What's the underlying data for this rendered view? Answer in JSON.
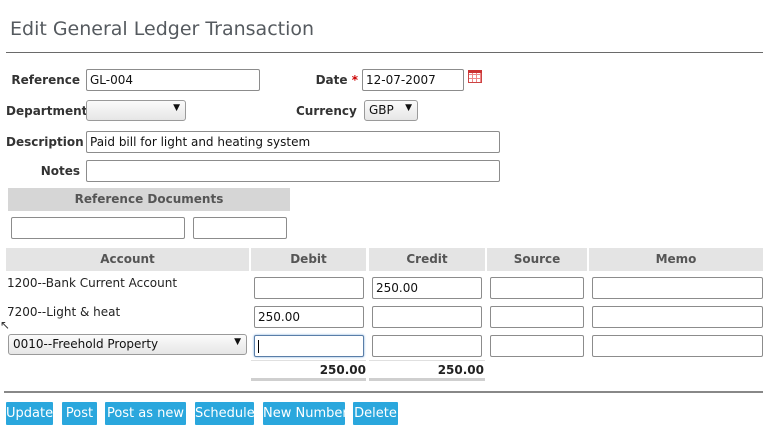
{
  "page": {
    "title": "Edit General Ledger Transaction"
  },
  "form": {
    "reference_label": "Reference",
    "reference_value": "GL-004",
    "date_label": "Date",
    "date_required_mark": "*",
    "date_value": "12-07-2007",
    "department_label": "Department",
    "department_value": "",
    "currency_label": "Currency",
    "currency_value": "GBP",
    "description_label": "Description",
    "description_value": "Paid bill for light and heating system",
    "notes_label": "Notes",
    "notes_value": ""
  },
  "reference_documents": {
    "header": "Reference Documents",
    "field1_value": "",
    "field2_value": ""
  },
  "table": {
    "headers": {
      "account": "Account",
      "debit": "Debit",
      "credit": "Credit",
      "source": "Source",
      "memo": "Memo"
    },
    "rows": [
      {
        "account": "1200--Bank Current Account",
        "debit": "",
        "credit": "250.00",
        "source": "",
        "memo": ""
      },
      {
        "account": "7200--Light & heat",
        "debit": "250.00",
        "credit": "",
        "source": "",
        "memo": ""
      },
      {
        "account": "0010--Freehold Property",
        "debit": "",
        "credit": "",
        "source": "",
        "memo": ""
      }
    ],
    "totals": {
      "debit": "250.00",
      "credit": "250.00"
    }
  },
  "buttons": {
    "update": "Update",
    "post": "Post",
    "post_as_new": "Post as new",
    "schedule": "Schedule",
    "new_number": "New Number",
    "delete": "Delete"
  },
  "icons": {
    "dropdown_arrow": "▼",
    "calendar": "calendar-icon"
  },
  "colors": {
    "button_bg": "#2aa7dd",
    "required": "#cc0000",
    "header_bg": "#e4e4e4"
  }
}
